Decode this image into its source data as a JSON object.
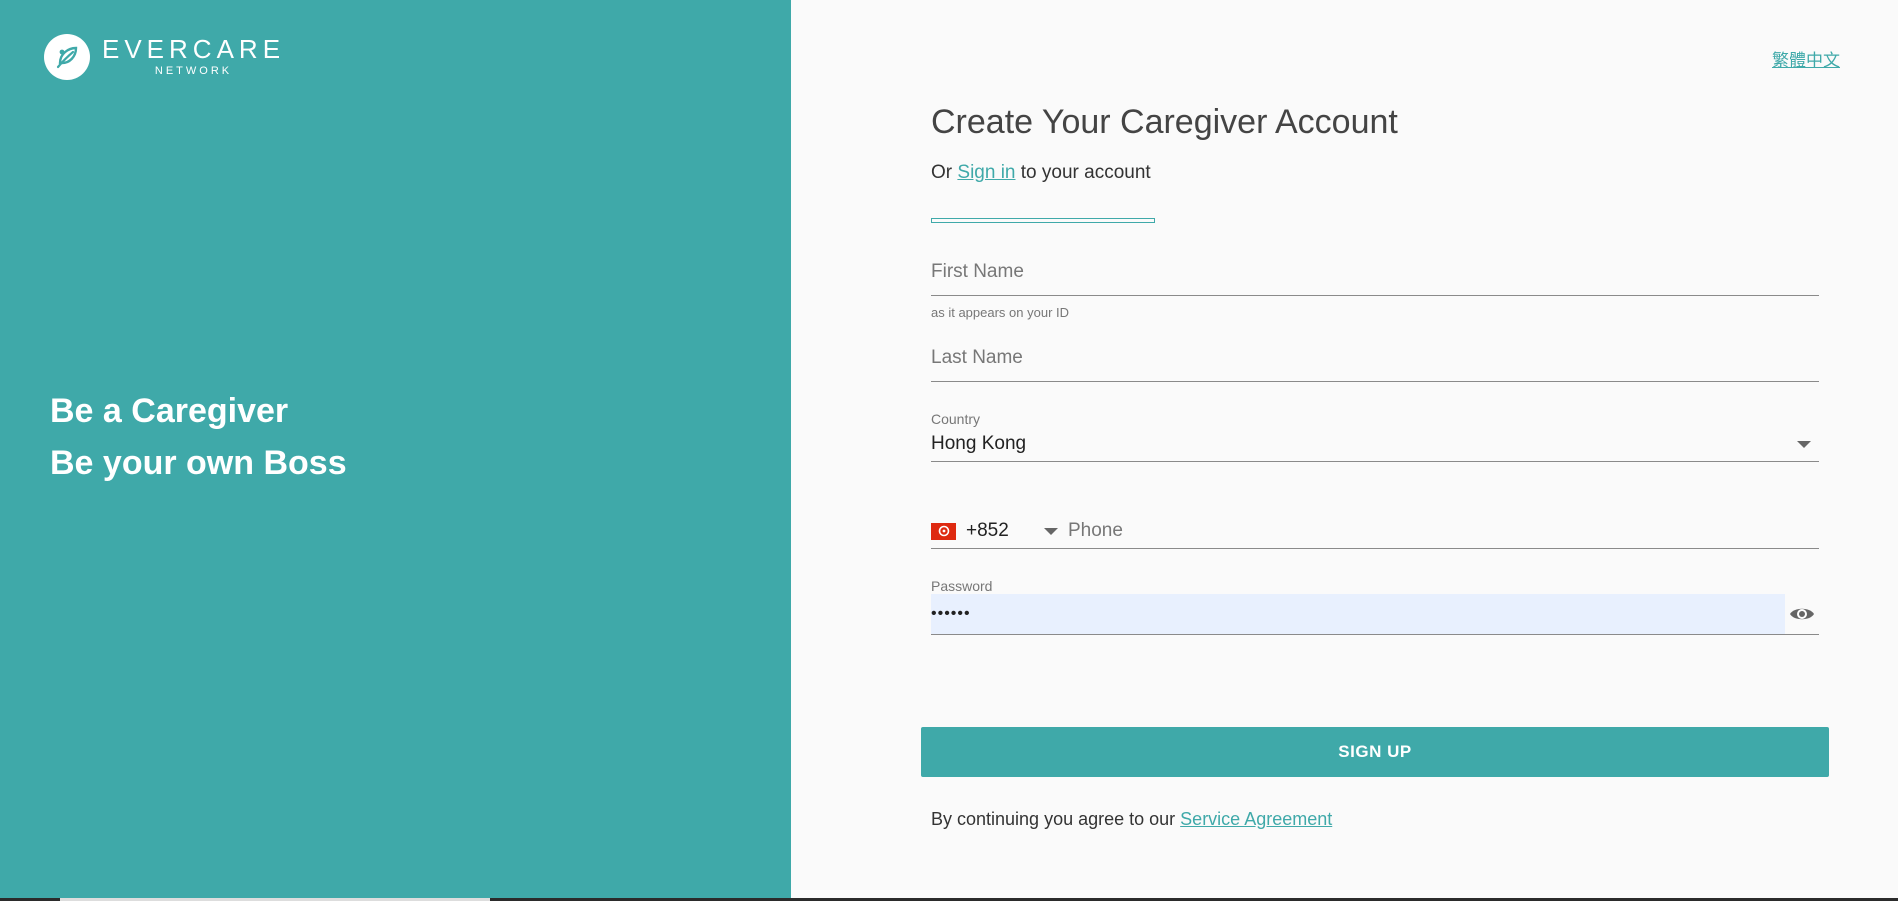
{
  "brand": {
    "name": "EVERCARE",
    "sub": "NETWORK"
  },
  "tagline": {
    "line1": "Be a Caregiver",
    "line2": "Be your own Boss"
  },
  "language_link": "繁體中文",
  "form": {
    "title": "Create Your Caregiver Account",
    "subtitle_prefix": "Or ",
    "signin_link": "Sign in",
    "subtitle_suffix": " to your account",
    "first_name_placeholder": "First Name",
    "first_name_helper": "as it appears on your ID",
    "last_name_placeholder": "Last Name",
    "country_label": "Country",
    "country_value": "Hong Kong",
    "phone_code": "+852",
    "phone_placeholder": "Phone",
    "password_label": "Password",
    "password_value": "••••••",
    "signup_label": "SIGN UP",
    "agreement_prefix": "By continuing you agree to our ",
    "agreement_link": "Service Agreement"
  },
  "colors": {
    "accent": "#3fa9a9",
    "autofill": "#e8f0fe",
    "flag": "#de2910"
  }
}
